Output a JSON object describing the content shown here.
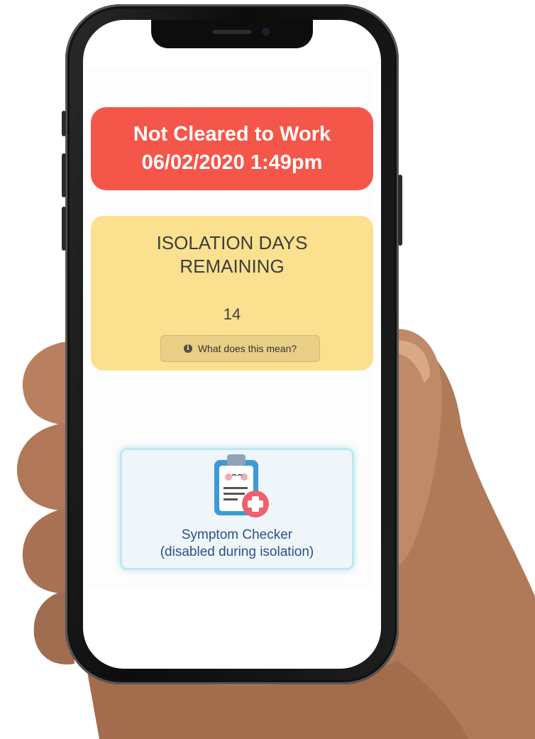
{
  "status": {
    "title": "Not Cleared to Work",
    "timestamp": "06/02/2020 1:49pm",
    "color": "#f4564a"
  },
  "isolation": {
    "title_line1": "ISOLATION DAYS",
    "title_line2": "REMAINING",
    "days_remaining": "14",
    "info_button_label": "What does this mean?",
    "info_icon": "info-circle-icon",
    "color": "#fbe08f"
  },
  "symptom_checker": {
    "label_line1": "Symptom Checker",
    "label_line2": "(disabled during isolation)",
    "icon": "clipboard-medical-icon"
  }
}
